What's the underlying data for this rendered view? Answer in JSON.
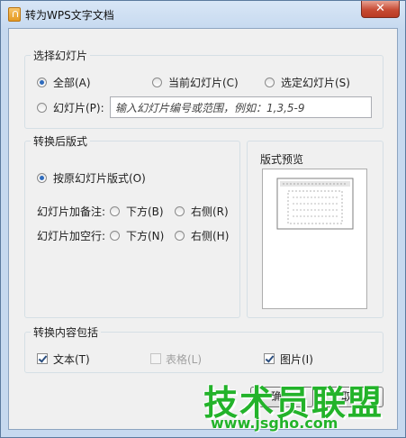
{
  "window": {
    "title": "转为WPS文字文档",
    "close_symbol": "✕"
  },
  "slide_select": {
    "group_title": "选择幻灯片",
    "options": [
      {
        "label": "全部(A)",
        "checked": true
      },
      {
        "label": "当前幻灯片(C)",
        "checked": false
      },
      {
        "label": "选定幻灯片(S)",
        "checked": false
      },
      {
        "label": "幻灯片(P):",
        "checked": false
      }
    ],
    "range_placeholder": "输入幻灯片编号或范围，例如：1,3,5-9"
  },
  "layout": {
    "group_title": "转换后版式",
    "original_option": "按原幻灯片版式(O)",
    "notes_label": "幻灯片加备注:",
    "notes_bottom": "下方(B)",
    "notes_right": "右侧(R)",
    "blank_label": "幻灯片加空行:",
    "blank_bottom": "下方(N)",
    "blank_right": "右侧(H)"
  },
  "preview": {
    "title": "版式预览"
  },
  "include": {
    "group_title": "转换内容包括",
    "text": "文本(T)",
    "table": "表格(L)",
    "image": "图片(I)"
  },
  "buttons": {
    "ok": "确定",
    "cancel": "取消"
  },
  "watermark": {
    "big": "技术员联盟",
    "small": "www.jsgho.com"
  }
}
